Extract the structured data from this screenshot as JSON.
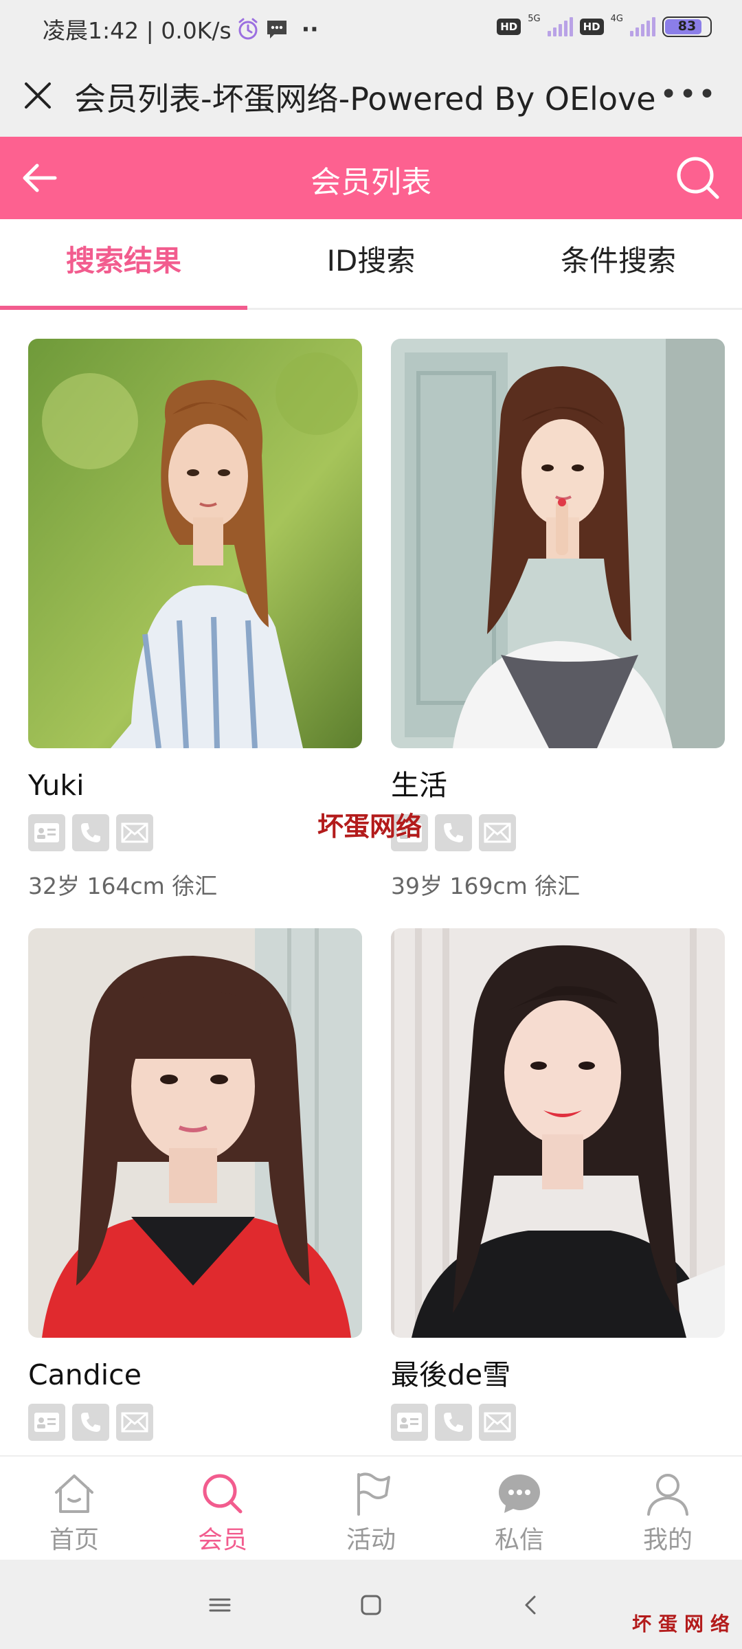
{
  "status_bar": {
    "time_speed": "凌晨1:42 | 0.0K/s",
    "alarm_icon": "alarm-clock-icon",
    "message_icon": "message-icon",
    "more_dots": "··",
    "hd1": "HD",
    "net1": "5G",
    "hd2": "HD",
    "net2": "4G",
    "battery": "83"
  },
  "browser": {
    "title": "会员列表-坏蛋网络-Powered By OElove",
    "more": "•••"
  },
  "header": {
    "title": "会员列表"
  },
  "tabs": [
    {
      "label": "搜索结果",
      "active": true
    },
    {
      "label": "ID搜索",
      "active": false
    },
    {
      "label": "条件搜索",
      "active": false
    }
  ],
  "members": [
    {
      "name": "Yuki",
      "info": "32岁 164cm 徐汇"
    },
    {
      "name": "生活",
      "info": "39岁 169cm 徐汇"
    },
    {
      "name": "Candice",
      "info": ""
    },
    {
      "name": "最後de雪",
      "info": ""
    }
  ],
  "watermark": "坏蛋网络",
  "corner_watermark": "坏蛋网络",
  "bottom_nav": [
    {
      "label": "首页",
      "icon": "home-icon",
      "active": false
    },
    {
      "label": "会员",
      "icon": "search-icon",
      "active": true
    },
    {
      "label": "活动",
      "icon": "flag-icon",
      "active": false
    },
    {
      "label": "私信",
      "icon": "chat-icon",
      "active": false
    },
    {
      "label": "我的",
      "icon": "user-icon",
      "active": false
    }
  ],
  "colors": {
    "accent": "#fd6190",
    "tab_active": "#f25c8e"
  }
}
